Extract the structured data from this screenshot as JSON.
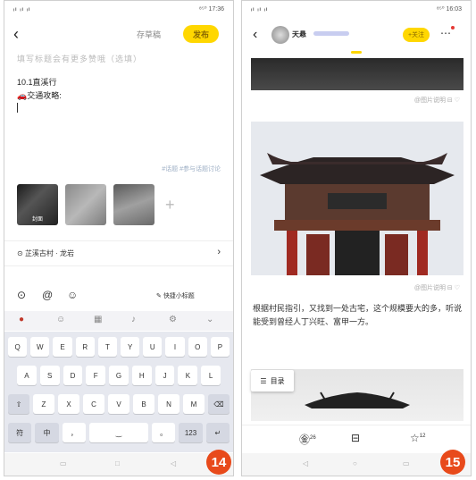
{
  "left_screen": {
    "status": {
      "signal": "ᵢₗ ᵢₗ ᵢₗ",
      "time": "⁸⁵⁰ 17:36"
    },
    "topbar": {
      "back_icon": "chevron-left-icon",
      "draft_label": "存草稿",
      "publish_label": "发布"
    },
    "editor": {
      "title_placeholder": "填写标题会有更多赞哦（选填）",
      "line1": "10.1直溪行",
      "line2_icon": "🚗",
      "line2": "交通攻略:"
    },
    "topic_hint": "#话题  #参与话题讨论",
    "images": [
      {
        "label": "封面"
      },
      {
        "label": ""
      },
      {
        "label": ""
      }
    ],
    "add_image_icon": "+",
    "location": {
      "icon": "location-icon",
      "text": "芷溪古村 · 龙岩",
      "chevron": "›"
    },
    "tools": {
      "quick_title_label": "快捷小标题"
    },
    "keyboard": {
      "row1": [
        "Q",
        "W",
        "E",
        "R",
        "T",
        "Y",
        "U",
        "I",
        "O",
        "P"
      ],
      "row2": [
        "A",
        "S",
        "D",
        "F",
        "G",
        "H",
        "J",
        "K",
        "L"
      ],
      "row3": [
        "⇧",
        "Z",
        "X",
        "C",
        "V",
        "B",
        "N",
        "M",
        "⌫"
      ],
      "row4": [
        "符",
        "中",
        "，",
        "‿",
        "。",
        "123",
        "↵"
      ]
    },
    "step_badge": "14"
  },
  "right_screen": {
    "status": {
      "signal": "ᵢₗ ᵢₗ ᵢₗ",
      "time": "⁸⁵⁰ 16:03"
    },
    "topbar": {
      "back_icon": "chevron-left-icon",
      "author": "天悬",
      "follow_label": "+关注",
      "more_icon": "more-icon"
    },
    "image_caption_1": "@图片说明",
    "image_caption_2": "@图片说明",
    "paragraph": "根据村民指引，又找到一处古宅，这个规模要大的多，听说能受到曾经人丁兴旺、富甲一方。",
    "toc_label": "目录",
    "actions": {
      "comments_count": "26",
      "favorite_count": "12"
    },
    "step_badge": "15"
  }
}
